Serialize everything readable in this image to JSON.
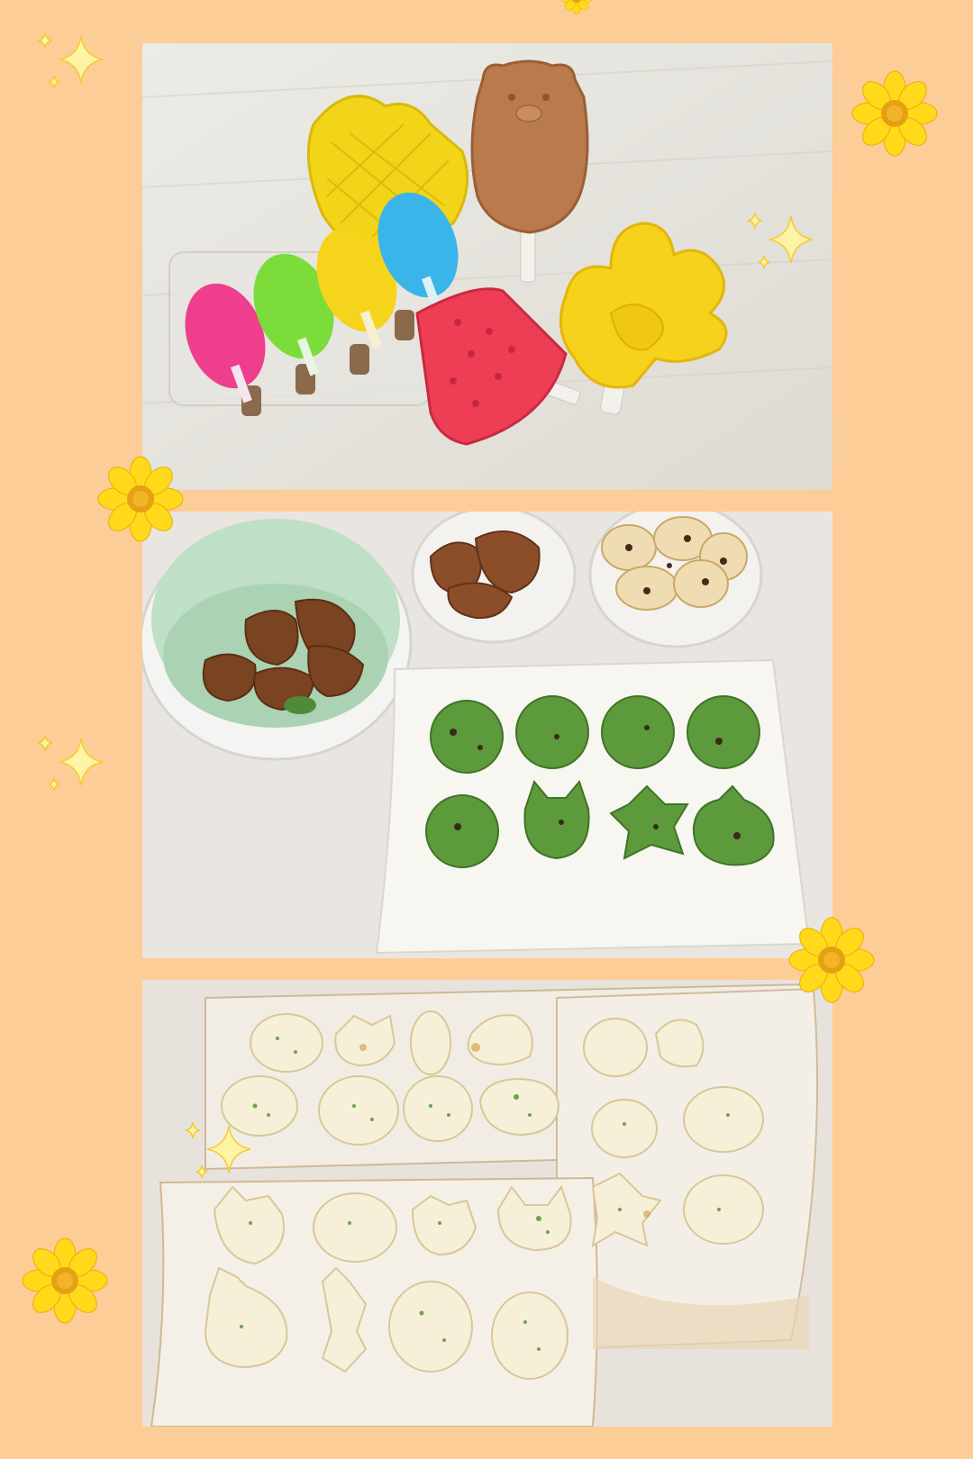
{
  "collage": {
    "background_color": "#fccd96",
    "panels": [
      {
        "id": "popsicle-molds-photo",
        "subject": "popsicle-molds"
      },
      {
        "id": "brown-and-green-cookies-photo",
        "subject": "cookies"
      },
      {
        "id": "white-cookies-photo",
        "subject": "cookies"
      }
    ],
    "decorations": {
      "flower_icon": "flower-icon",
      "sparkle_icon": "sparkle-icon",
      "flower_color": "#ffd91a",
      "flower_center_color": "#e6a012"
    }
  }
}
